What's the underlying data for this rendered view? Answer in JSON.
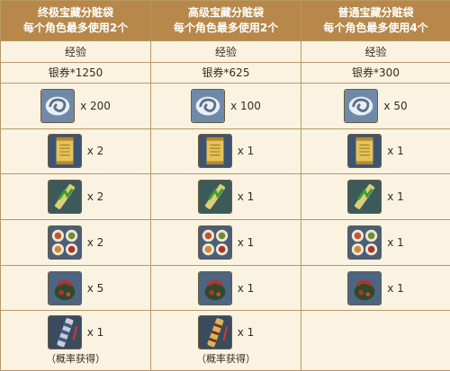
{
  "columns": [
    {
      "title": "终极宝藏分赃袋",
      "limit": "每个角色最多使用2个",
      "exp": "经验",
      "silver": "银券*1250",
      "items": [
        {
          "icon": "swirl-orb-icon",
          "qty": "x 200"
        },
        {
          "icon": "golden-scroll-icon",
          "qty": "x 2"
        },
        {
          "icon": "green-scroll-icon",
          "qty": "x 2"
        },
        {
          "icon": "food-plates-icon",
          "qty": "x 2"
        },
        {
          "icon": "treasure-pouch-icon",
          "qty": "x 5"
        },
        {
          "icon": "weapon-case-icon",
          "qty": "x 1",
          "note": "（概率获得）"
        }
      ]
    },
    {
      "title": "高级宝藏分赃袋",
      "limit": "每个角色最多使用2个",
      "exp": "经验",
      "silver": "银券*625",
      "items": [
        {
          "icon": "swirl-orb-icon",
          "qty": "x 100"
        },
        {
          "icon": "golden-scroll-icon",
          "qty": "x 1"
        },
        {
          "icon": "green-scroll-icon",
          "qty": "x 1"
        },
        {
          "icon": "food-plates-icon",
          "qty": "x 1"
        },
        {
          "icon": "treasure-pouch-icon",
          "qty": "x 1"
        },
        {
          "icon": "weapon-case-icon",
          "qty": "x 1",
          "note": "（概率获得）"
        }
      ]
    },
    {
      "title": "普通宝藏分赃袋",
      "limit": "每个角色最多使用4个",
      "exp": "经验",
      "silver": "银券*300",
      "items": [
        {
          "icon": "swirl-orb-icon",
          "qty": "x 50"
        },
        {
          "icon": "golden-scroll-icon",
          "qty": "x 1"
        },
        {
          "icon": "green-scroll-icon",
          "qty": "x 1"
        },
        {
          "icon": "food-plates-icon",
          "qty": "x 1"
        },
        {
          "icon": "treasure-pouch-icon",
          "qty": "x 1"
        }
      ]
    }
  ],
  "colors": {
    "header_bg": "#b7884a",
    "cell_bg": "#fbf3e2",
    "border": "#b89863",
    "header_text": "#ffffff"
  }
}
